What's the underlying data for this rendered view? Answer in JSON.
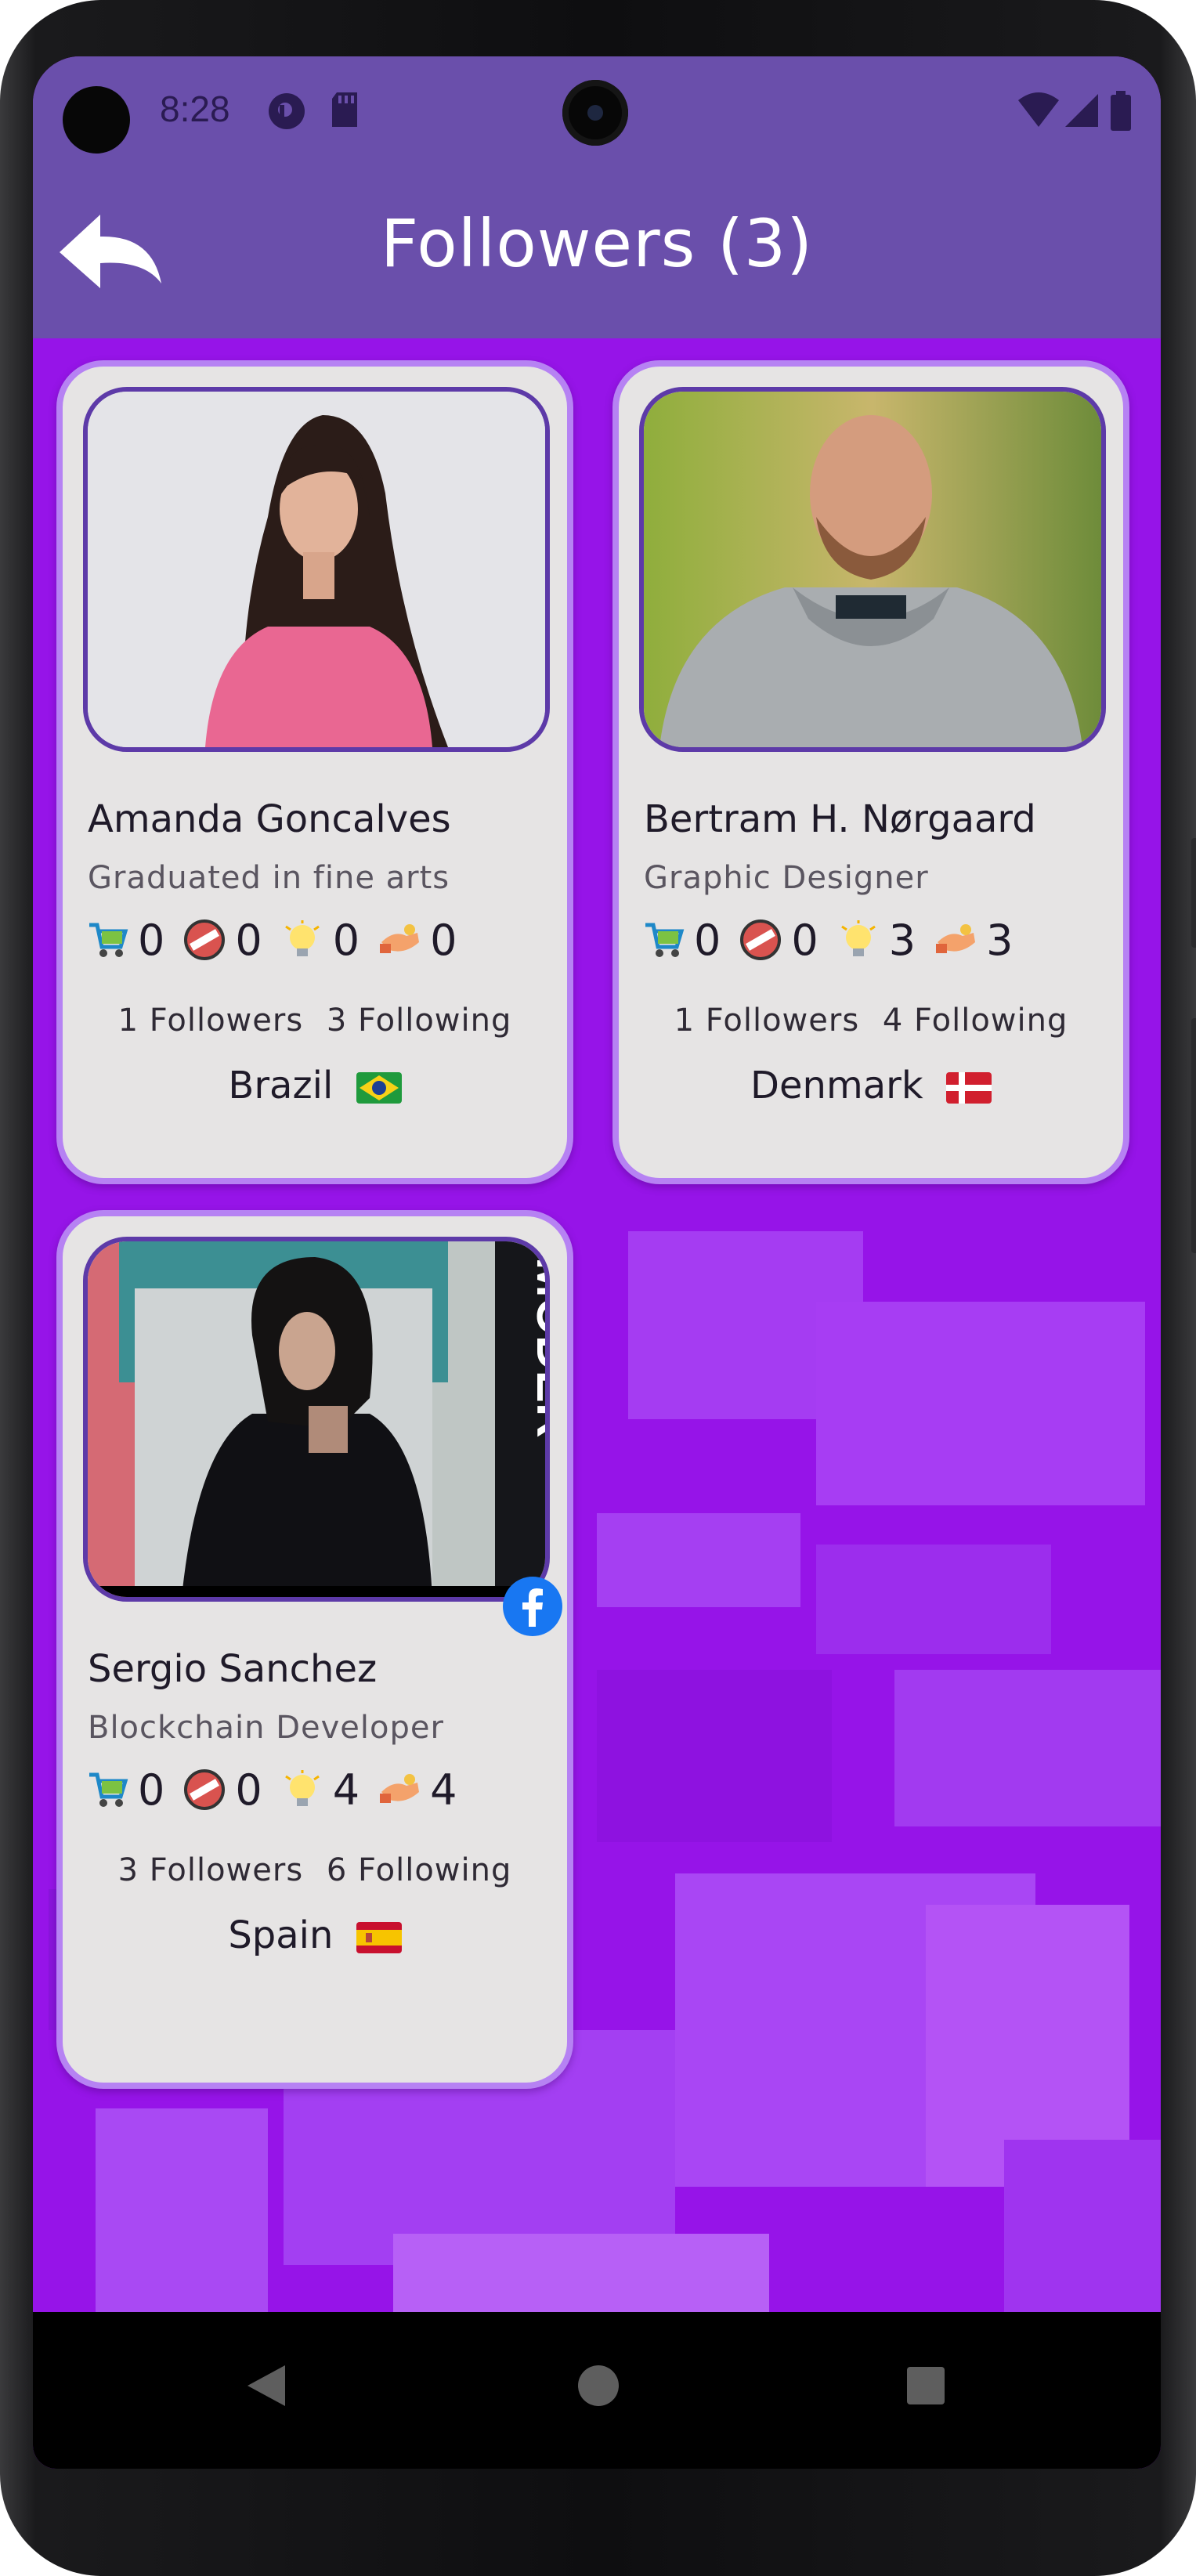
{
  "status_bar": {
    "time": "8:28"
  },
  "header": {
    "title": "Followers (3)"
  },
  "followers": [
    {
      "name": "Amanda Goncalves",
      "job": "Graduated in fine arts",
      "stats": [
        "0",
        "0",
        "0",
        "0"
      ],
      "followers": "1 Followers",
      "following": "3 Following",
      "country": "Brazil"
    },
    {
      "name": "Bertram H. Nørgaard",
      "job": "Graphic Designer",
      "stats": [
        "0",
        "0",
        "3",
        "3"
      ],
      "followers": "1 Followers",
      "following": "4 Following",
      "country": "Denmark"
    },
    {
      "name": "Sergio Sanchez",
      "job": "Blockchain Developer",
      "stats": [
        "0",
        "0",
        "4",
        "4"
      ],
      "followers": "3 Followers",
      "following": "6 Following",
      "country": "Spain",
      "photo_text": "MODER"
    }
  ],
  "stat_icons": [
    "cart-icon",
    "no-entry-badge-icon",
    "lightbulb-icon",
    "handshake-icon"
  ],
  "colors": {
    "app_bar": "#6a4fab",
    "background": "#9614e8",
    "card": "#e6e4e4",
    "card_border": "#b682f3"
  }
}
